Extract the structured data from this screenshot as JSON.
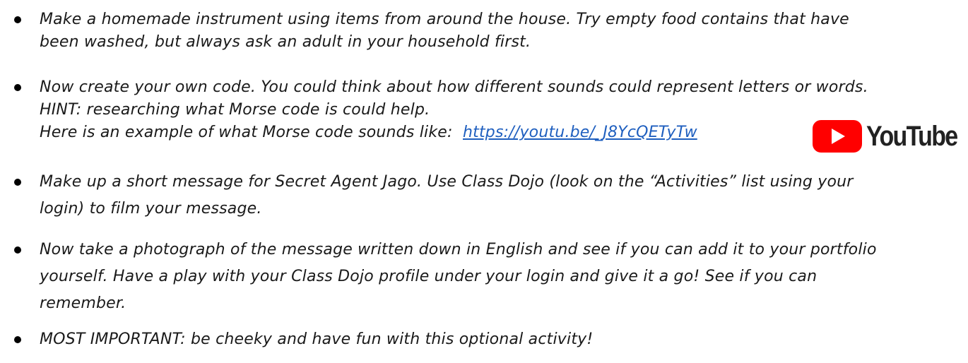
{
  "items": [
    {
      "lines": [
        "Make a homemade instrument using items from around the house.  Try empty food contains that have",
        "been washed, but always ask an adult in your household first."
      ]
    },
    {
      "lines": [
        "Now create your own code.  You could think about how different sounds could represent letters or words.",
        "HINT:  researching what Morse code is could help.",
        "Here is an example of what Morse code sounds like:  "
      ],
      "link_text": "https://youtu.be/_J8YcQETyTw"
    },
    {
      "lines": [
        "Make up a short message for Secret Agent Jago.  Use Class Dojo (look on the “Activities” list using your",
        "login) to film your message."
      ]
    },
    {
      "lines": [
        "Now take a photograph of the message written down in English and see if you can add it to your portfolio",
        "yourself.  Have a play with your Class Dojo profile under your login and give it a go!  See if you can",
        "remember."
      ]
    },
    {
      "lines": [
        "MOST IMPORTANT:  be cheeky and have fun with this optional activity!"
      ]
    }
  ],
  "youtube_logo": {
    "wordmark": "YouTube",
    "icon": "youtube-play-icon",
    "color": "#ff0000"
  },
  "colors": {
    "text": "#1a1a1a",
    "link": "#1f5fbf"
  }
}
